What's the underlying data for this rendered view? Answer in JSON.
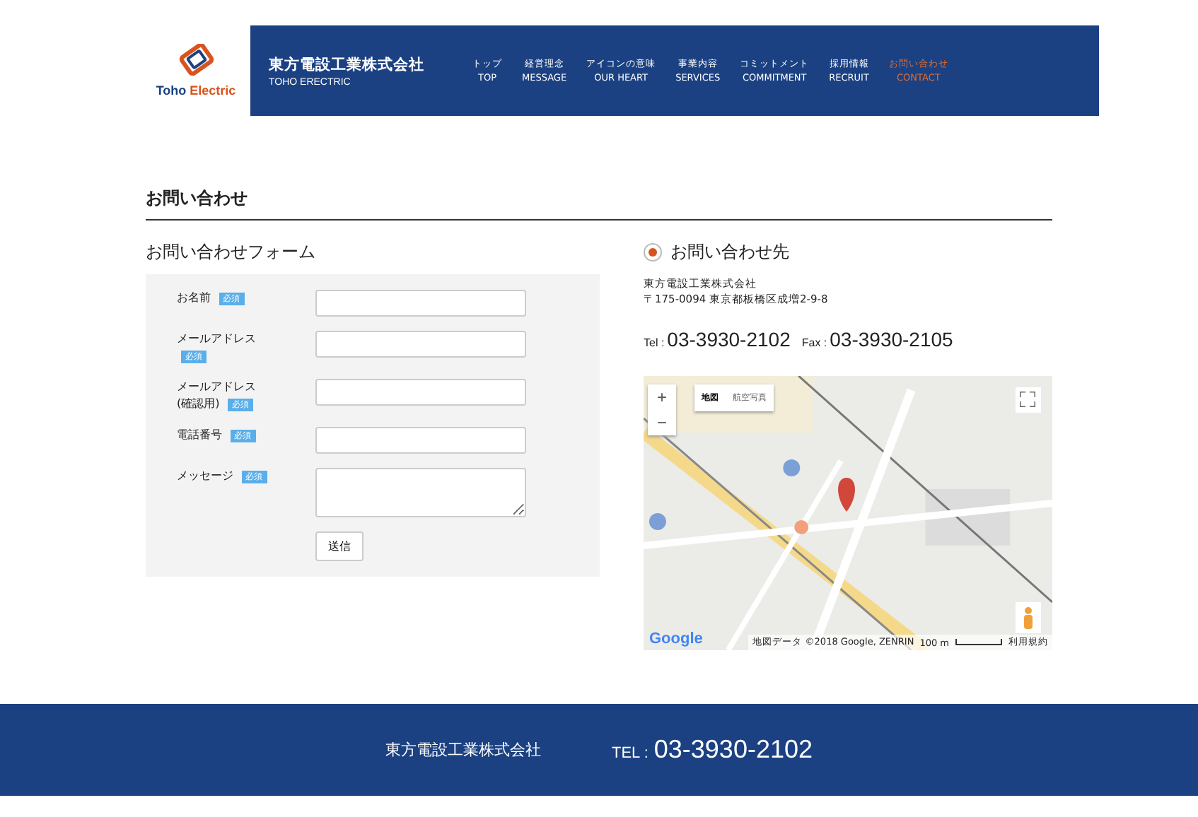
{
  "header": {
    "logo_text": "Toho",
    "logo_text_accent": "Electric",
    "company": "東方電設工業株式会社",
    "company_en": "TOHO ERECTRIC",
    "nav": [
      {
        "ja": "トップ",
        "en": "TOP",
        "selected": false
      },
      {
        "ja": "経営理念",
        "en": "MESSAGE",
        "selected": false
      },
      {
        "ja": "アイコンの意味",
        "en": "OUR HEART",
        "selected": false
      },
      {
        "ja": "事業内容",
        "en": "SERVICES",
        "selected": false
      },
      {
        "ja": "コミットメント",
        "en": "COMMITMENT",
        "selected": false
      },
      {
        "ja": "採用情報",
        "en": "RECRUIT",
        "selected": false
      },
      {
        "ja": "お問い合わせ",
        "en": "CONTACT",
        "selected": true
      }
    ]
  },
  "page_title": "お問い合わせ",
  "form": {
    "title": "お問い合わせフォーム",
    "submit": "送信",
    "fields": [
      {
        "label_lines": [
          "お名前"
        ],
        "required": "必須",
        "kind": "text"
      },
      {
        "label_lines": [
          "メールアドレス"
        ],
        "required": "必須",
        "kind": "text"
      },
      {
        "label_lines": [
          "メールアドレス",
          "(確認用)"
        ],
        "required": "必須",
        "kind": "text"
      },
      {
        "label_lines": [
          "電話番号"
        ],
        "required": "必須",
        "kind": "text"
      },
      {
        "label_lines": [
          "メッセージ"
        ],
        "required": "必須",
        "kind": "textarea"
      }
    ]
  },
  "contact": {
    "title": "お問い合わせ先",
    "company": "東方電設工業株式会社",
    "address": "〒175-0094 東京都板橋区成増2-9-8",
    "tel_label": "Tel :",
    "tel": "03-3930-2102",
    "fax_label": "Fax :",
    "fax": "03-3930-2105",
    "map": {
      "kind": "picture",
      "zoom_in": "+",
      "zoom_out": "−",
      "map_types": [
        {
          "label": "地図",
          "selected": true
        },
        {
          "label": "航空写真",
          "selected": false
        }
      ],
      "logo": "Google",
      "attribution": "地図データ ©2018 Google, ZENRIN",
      "scale": "100 m",
      "terms": "利用規約"
    }
  },
  "footer": {
    "company": "東方電設工業株式会社",
    "tel_label": "TEL :",
    "tel": "03-3930-2102"
  }
}
